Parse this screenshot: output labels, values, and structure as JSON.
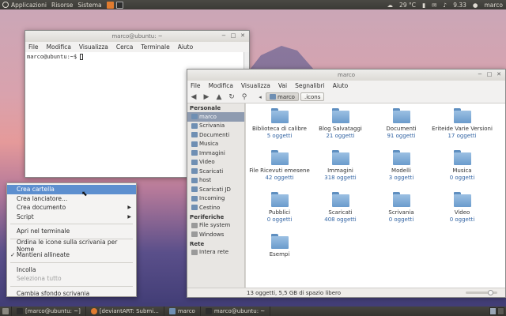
{
  "top_panel": {
    "menus": [
      "Applicazioni",
      "Risorse",
      "Sistema"
    ],
    "weather": "29 °C",
    "time": "9.33",
    "user": "marco"
  },
  "terminal": {
    "title": "marco@ubuntu: ~",
    "menus": [
      "File",
      "Modifica",
      "Visualizza",
      "Cerca",
      "Terminale",
      "Aiuto"
    ],
    "prompt": "marco@ubuntu:~$ "
  },
  "file_manager": {
    "title": "marco",
    "menus": [
      "File",
      "Modifica",
      "Visualizza",
      "Vai",
      "Segnalibri",
      "Aiuto"
    ],
    "path": [
      "marco",
      ".icons"
    ],
    "sidebar": {
      "places_header": "Personale",
      "places": [
        "marco",
        "Scrivania",
        "Documenti",
        "Musica",
        "Immagini",
        "Video",
        "Scaricati",
        "host",
        "Scaricati JD",
        "Incoming",
        "Cestino"
      ],
      "devices_header": "Periferiche",
      "devices": [
        "File system",
        "Windows"
      ],
      "network_header": "Rete",
      "network": [
        "Intera rete"
      ]
    },
    "items": [
      {
        "name": "Biblioteca di calibre",
        "count": "5 oggetti"
      },
      {
        "name": "Blog Salvataggi",
        "count": "21 oggetti"
      },
      {
        "name": "Documenti",
        "count": "91 oggetti"
      },
      {
        "name": "Eriteide Varie Versioni",
        "count": "17 oggetti"
      },
      {
        "name": "File Ricevuti emesene",
        "count": "42 oggetti"
      },
      {
        "name": "Immagini",
        "count": "318 oggetti"
      },
      {
        "name": "Modelli",
        "count": "3 oggetti"
      },
      {
        "name": "Musica",
        "count": "0 oggetti"
      },
      {
        "name": "Pubblici",
        "count": "0 oggetti"
      },
      {
        "name": "Scaricati",
        "count": "408 oggetti"
      },
      {
        "name": "Scrivania",
        "count": "0 oggetti"
      },
      {
        "name": "Video",
        "count": "0 oggetti"
      },
      {
        "name": "Esempi",
        "count": ""
      }
    ],
    "status": "13 oggetti, 5,5 GB di spazio libero"
  },
  "context_menu": {
    "group1": [
      "Crea cartella",
      "Crea lanciatore...",
      "Crea documento",
      "Script"
    ],
    "group2": [
      "Apri nel terminale"
    ],
    "group3": [
      "Ordina le icone sulla scrivania per Nome",
      "Mantieni allineate"
    ],
    "group4": [
      "Incolla",
      "Seleziona tutto"
    ],
    "group5": [
      "Cambia sfondo scrivania"
    ]
  },
  "bottom_panel": {
    "tasks": [
      "[marco@ubuntu: ~]",
      "[deviantART: Submi...",
      "marco",
      "marco@ubuntu: ~"
    ]
  }
}
